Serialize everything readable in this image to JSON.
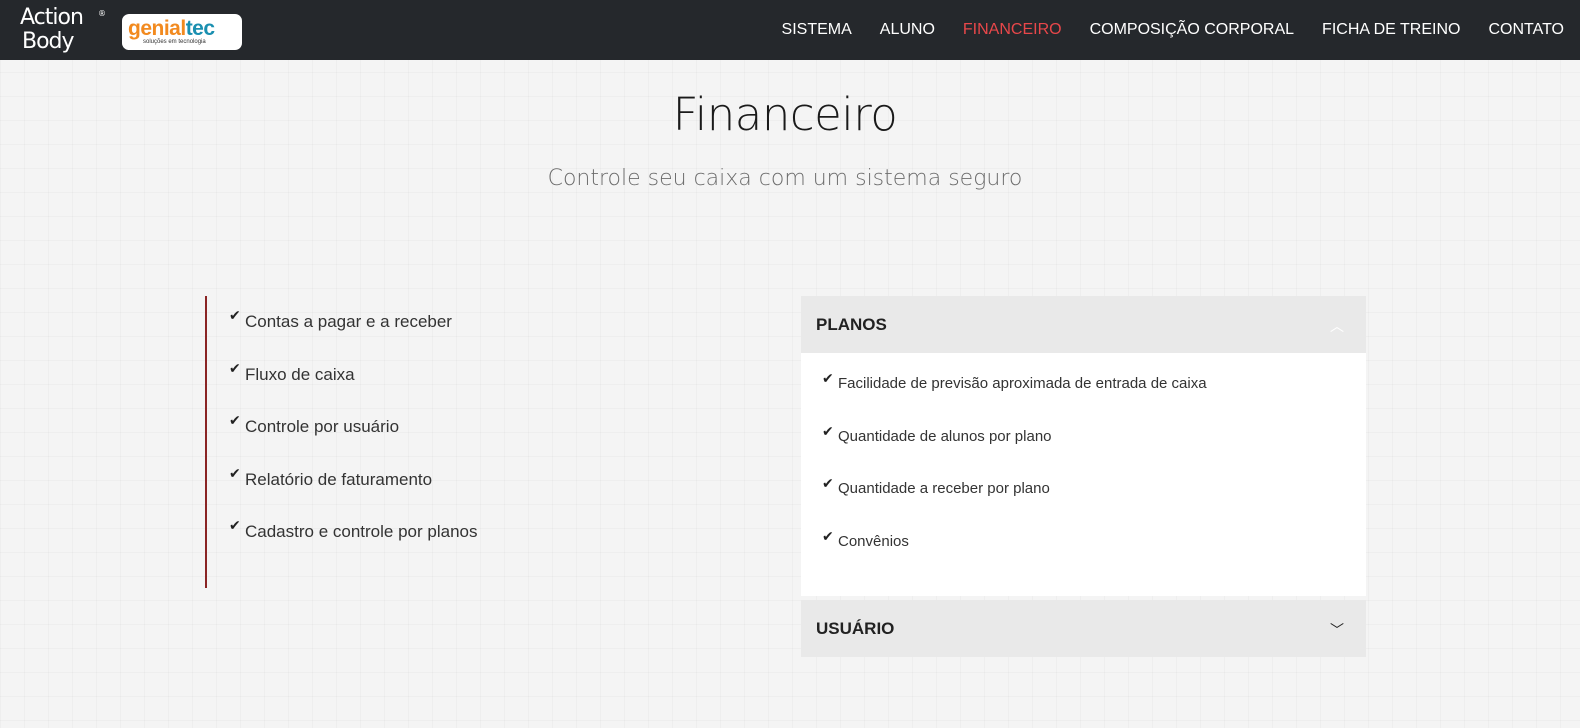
{
  "brand": {
    "logo_line1": "Action",
    "logo_line2": "Body",
    "logo_reg": "®",
    "partner_name_a": "genial",
    "partner_name_b": "tec",
    "partner_tagline": "soluções em tecnologia"
  },
  "nav": {
    "items": [
      {
        "label": "SISTEMA",
        "active": false
      },
      {
        "label": "ALUNO",
        "active": false
      },
      {
        "label": "FINANCEIRO",
        "active": true
      },
      {
        "label": "COMPOSIÇÃO CORPORAL",
        "active": false
      },
      {
        "label": "FICHA DE TREINO",
        "active": false
      },
      {
        "label": "CONTATO",
        "active": false
      }
    ]
  },
  "page": {
    "title": "Financeiro",
    "subtitle": "Controle seu caixa com um sistema seguro"
  },
  "features": [
    "Contas a pagar e a receber",
    "Fluxo de caixa",
    "Controle por usuário",
    "Relatório de faturamento",
    "Cadastro e controle por planos"
  ],
  "accordion": {
    "sections": [
      {
        "title": "PLANOS",
        "expanded": true,
        "items": [
          "Facilidade de previsão aproximada de entrada de caixa",
          "Quantidade de alunos por plano",
          "Quantidade a receber por plano",
          "Convênios"
        ]
      },
      {
        "title": "USUÁRIO",
        "expanded": false,
        "items": []
      }
    ]
  },
  "icons": {
    "check": "check-icon",
    "chevron_up": "chevron-up-icon",
    "chevron_down": "chevron-down-icon"
  },
  "colors": {
    "navbar_bg": "#25282c",
    "nav_active": "#e8474a",
    "feature_border": "#8a2424",
    "accordion_header_bg": "#e9e9e9"
  }
}
